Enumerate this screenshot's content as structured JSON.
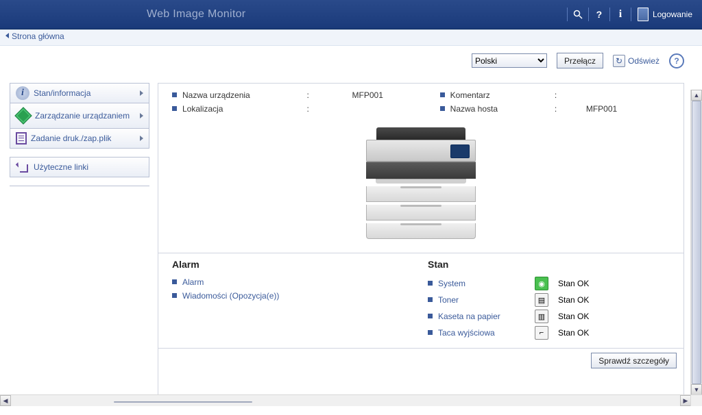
{
  "header": {
    "title": "Web Image Monitor",
    "login": "Logowanie"
  },
  "breadcrumb": {
    "home": "Strona główna"
  },
  "tools": {
    "language_options": "Polski",
    "switch": "Przełącz",
    "refresh": "Odśwież"
  },
  "sidebar": {
    "items": [
      {
        "label": "Stan/informacja"
      },
      {
        "label": "Zarządzanie urządzaniem"
      },
      {
        "label": "Zadanie druk./zap.plik"
      }
    ],
    "useful_links": "Użyteczne linki"
  },
  "info": {
    "device_name_label": "Nazwa urządzenia",
    "device_name": "MFP001",
    "location_label": "Lokalizacja",
    "location": "",
    "comment_label": "Komentarz",
    "comment": "",
    "host_label": "Nazwa hosta",
    "host": "MFP001"
  },
  "alarm": {
    "heading": "Alarm",
    "items": [
      "Alarm",
      "Wiadomości (Opozycja(e))"
    ]
  },
  "status": {
    "heading": "Stan",
    "rows": [
      {
        "label": "System",
        "state": "Stan OK"
      },
      {
        "label": "Toner",
        "state": "Stan OK"
      },
      {
        "label": "Kaseta na papier",
        "state": "Stan OK"
      },
      {
        "label": "Taca wyjściowa",
        "state": "Stan OK"
      }
    ],
    "details_btn": "Sprawdź szczegóły"
  }
}
